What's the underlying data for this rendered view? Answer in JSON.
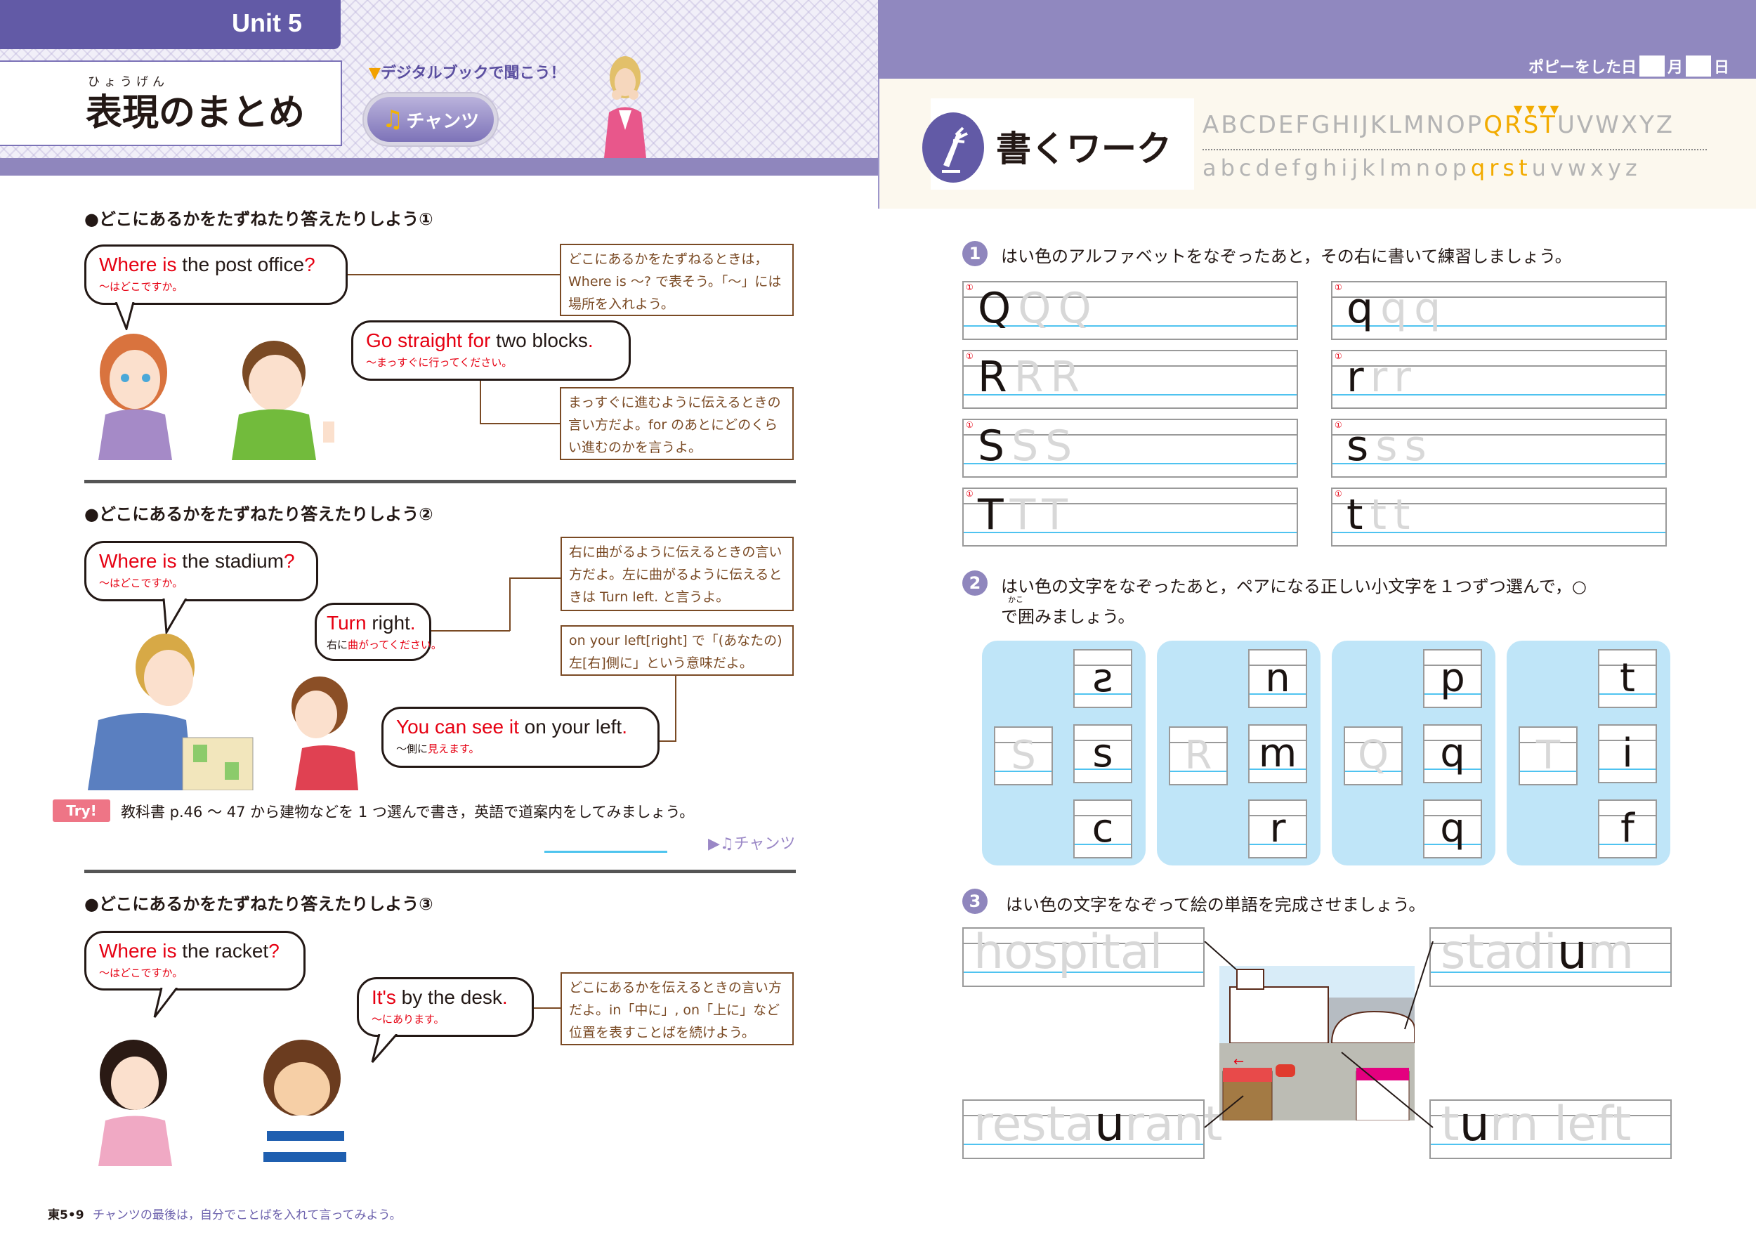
{
  "left_page": {
    "unit_label": "Unit 5",
    "title_ruby": "ひょうげん",
    "title": "表現のまとめ",
    "digital_note_arrow": "▼",
    "digital_note": "デジタルブックで聞こう！",
    "chant_button": {
      "icon": "music-note-icon",
      "glyph": "♫",
      "label": "チャンツ"
    },
    "sections": [
      {
        "heading": "●どこにあるかをたずねたり答えたりしよう①",
        "bubbles": [
          {
            "en_red": "Where is",
            "en_black": " the post office",
            "en_end": "?",
            "jp": "～はどこですか。"
          },
          {
            "en_red": "Go straight for",
            "en_black": " two blocks",
            "en_end": ".",
            "jp": "～まっすぐに行ってください。"
          }
        ],
        "notes": [
          "どこにあるかをたずねるときは，Where is ～? で表そう。「～」には場所を入れよう。",
          "まっすぐに進むように伝えるときの言い方だよ。for のあとにどのくらい進むのかを言うよ。"
        ]
      },
      {
        "heading": "●どこにあるかをたずねたり答えたりしよう②",
        "bubbles": [
          {
            "en_red": "Where is",
            "en_black": " the stadium",
            "en_end": "?",
            "jp": "～はどこですか。"
          },
          {
            "en_red": "Turn",
            "en_black": " right",
            "en_end": ".",
            "jp_black": "右に",
            "jp": "曲がってください。"
          },
          {
            "en_red": "You can see it",
            "en_black": " on your left",
            "en_end": ".",
            "jp_black": "～側に",
            "jp": "見えます。"
          }
        ],
        "notes": [
          "右に曲がるように伝えるときの言い方だよ。左に曲がるように伝えるときは Turn left. と言うよ。",
          "on your left[right] で「(あなたの) 左[右]側に」という意味だよ。"
        ],
        "try": {
          "badge": "Try!",
          "text": "教科書 p.46 ～ 47 から建物などを 1 つ選んで書き，英語で道案内をしてみましょう。",
          "chant_link": "▶♫チャンツ"
        }
      },
      {
        "heading": "●どこにあるかをたずねたり答えたりしよう③",
        "bubbles": [
          {
            "en_red": "Where is",
            "en_black": " the racket",
            "en_end": "?",
            "jp": "～はどこですか。"
          },
          {
            "en_red": "It's",
            "en_black": " by the desk",
            "en_end": ".",
            "jp": "～にあります。"
          }
        ],
        "notes": [
          "どこにあるかを伝えるときの言い方だよ。in「中に」, on「上に」など位置を表すことばを続けよう。"
        ]
      }
    ],
    "footer": {
      "code": "東5•9",
      "text": "チャンツの最後は，自分でことばを入れて言ってみよう。"
    }
  },
  "right_page": {
    "date_line": {
      "prefix": "ポピーをした日",
      "month": "月",
      "day": "日"
    },
    "work_title": "書くワーク",
    "work_icon": "pencil-hand-icon",
    "alphabet": {
      "upper_before": "ABCDEFGHIJKLMNOP",
      "upper_hl": "QRST",
      "upper_after": "UVWXYZ",
      "lower_before": "abcdefghijklmnop",
      "lower_hl": "qrst",
      "lower_after": "uvwxyz",
      "markers": "▼▼▼▼"
    },
    "q1": {
      "num": "1",
      "instruction": "はい色のアルファベットをなぞったあと，その右に書いて練習しましょう。",
      "rows": [
        {
          "upper": "Q",
          "lower": "q"
        },
        {
          "upper": "R",
          "lower": "r"
        },
        {
          "upper": "S",
          "lower": "s"
        },
        {
          "upper": "T",
          "lower": "t"
        }
      ]
    },
    "q2": {
      "num": "2",
      "instruction_line1": "はい色の文字をなぞったあと，ペアになる正しい小文字を１つずつ選んで，○",
      "ruby": "かこ",
      "instruction_line2": "で囲みましょう。",
      "cards": [
        {
          "trace": "S",
          "options": [
            "ƨ",
            "s",
            "c"
          ]
        },
        {
          "trace": "R",
          "options": [
            "n",
            "m",
            "r"
          ]
        },
        {
          "trace": "Q",
          "options": [
            "p",
            "q",
            "q"
          ]
        },
        {
          "trace": "T",
          "options": [
            "t",
            "i",
            "f"
          ]
        }
      ]
    },
    "q3": {
      "num": "3",
      "instruction": "はい色の文字をなぞって絵の単語を完成させましょう。",
      "words": [
        {
          "before": "hospital",
          "ink": "",
          "after": ""
        },
        {
          "before": "stadi",
          "ink": "u",
          "after": "m"
        },
        {
          "before": "resta",
          "ink": "u",
          "after": "rant"
        },
        {
          "before": "t",
          "ink": "u",
          "after": "rn left"
        }
      ]
    }
  }
}
